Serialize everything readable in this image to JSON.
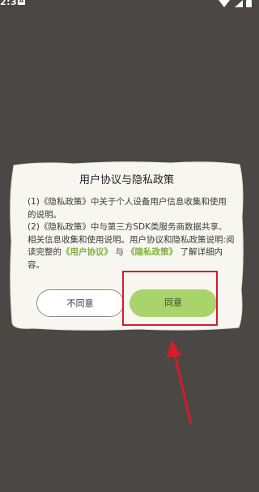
{
  "status_bar": {
    "time": "2:34",
    "notification_icon_letter": "A"
  },
  "dialog": {
    "title": "用户协议与隐私政策",
    "body": {
      "line1_text": "(1)《隐私政策》中关于个人设备用户信息收集和使用的说明。",
      "line2_text": "(2)《隐私政策》中与第三方SDK类服务商数据共享、相关信息收集和使用说明。用户协议和隐私政策说明:",
      "read_prefix": "阅读完整的",
      "user_agreement_link": "《用户协议》",
      "and_text": "与",
      "privacy_policy_link": "《隐私政策》",
      "read_suffix": "了解详细内容。"
    },
    "disagree_label": "不同意",
    "agree_label": "同意"
  },
  "colors": {
    "background": "#4a4744",
    "dialog": "#f7f6f0",
    "agree_button": "#a8d46b",
    "link": "#7fb43a",
    "annotation": "#d41c2a"
  }
}
